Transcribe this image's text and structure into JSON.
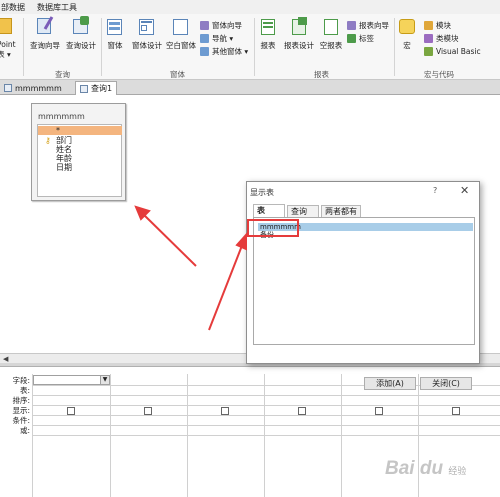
{
  "ribbon_tabs": [
    "部数据",
    "数据库工具"
  ],
  "ribbon": {
    "app_parts": [
      "ePoint",
      "表 ▾"
    ],
    "query_group": {
      "buttons": [
        "查询向导",
        "查询设计"
      ],
      "label": "查询"
    },
    "forms_group": {
      "buttons": [
        "窗体",
        "窗体设计",
        "空白窗体"
      ],
      "small": [
        "窗体向导",
        "导航 ▾",
        "其他窗体 ▾"
      ],
      "label": "窗体"
    },
    "reports_group": {
      "buttons": [
        "报表",
        "报表设计",
        "空报表"
      ],
      "small": [
        "报表向导",
        "标签"
      ],
      "label": "报表"
    },
    "macros_group": {
      "buttons": [
        "宏"
      ],
      "small": [
        "模块",
        "类模块",
        "Visual Basic"
      ],
      "label": "宏与代码"
    }
  },
  "doc_tabs": [
    "mmmmmm",
    "查询1"
  ],
  "field_list": {
    "title": "mmmmmm",
    "fields": [
      "*",
      "部门",
      "姓名",
      "年龄",
      "日期"
    ],
    "key_field": "部门"
  },
  "grid": {
    "row_labels": [
      "字段:",
      "表:",
      "排序:",
      "显示:",
      "条件:",
      "或:"
    ]
  },
  "dialog": {
    "title": "显示表",
    "help": "?",
    "close": "✕",
    "tabs": [
      "表",
      "查询",
      "两者都有"
    ],
    "items": [
      "mmmmmm",
      "备份"
    ],
    "selected_item": "mmmmmm",
    "add_button": "添加(A)",
    "close_button": "关闭(C)"
  },
  "watermark": {
    "main": "Bai du",
    "sub": "经验"
  },
  "colors": {
    "annotation_red": "#e53b3b",
    "selected_field": "#f4b57f",
    "selected_item": "#a8cde8"
  }
}
